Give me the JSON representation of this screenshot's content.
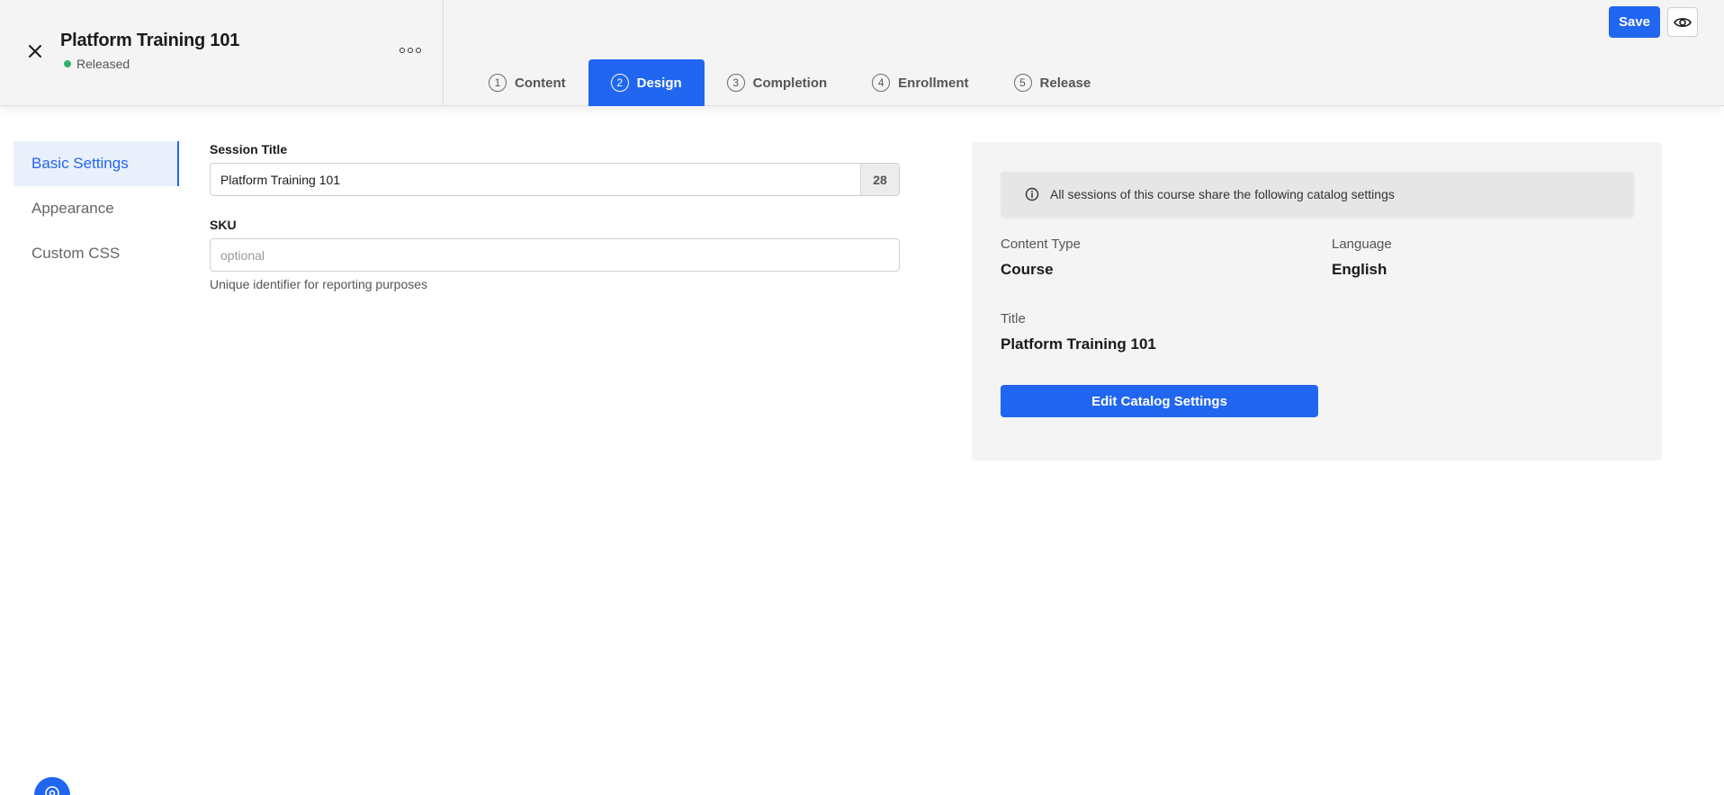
{
  "header": {
    "course_title": "Platform Training 101",
    "status": "Released",
    "status_color": "#2fb36b",
    "save_label": "Save"
  },
  "tabs": [
    {
      "num": "1",
      "label": "Content",
      "active": false
    },
    {
      "num": "2",
      "label": "Design",
      "active": true
    },
    {
      "num": "3",
      "label": "Completion",
      "active": false
    },
    {
      "num": "4",
      "label": "Enrollment",
      "active": false
    },
    {
      "num": "5",
      "label": "Release",
      "active": false
    }
  ],
  "side_nav": {
    "items": [
      {
        "label": "Basic Settings",
        "active": true
      },
      {
        "label": "Appearance",
        "active": false
      },
      {
        "label": "Custom CSS",
        "active": false
      }
    ]
  },
  "form": {
    "session_title_label": "Session Title",
    "session_title_value": "Platform Training 101",
    "session_title_count": "28",
    "sku_label": "SKU",
    "sku_value": "",
    "sku_placeholder": "optional",
    "sku_helper": "Unique identifier for reporting purposes"
  },
  "catalog": {
    "info_text": "All sessions of this course share the following catalog settings",
    "content_type_label": "Content Type",
    "content_type_value": "Course",
    "language_label": "Language",
    "language_value": "English",
    "title_label": "Title",
    "title_value": "Platform Training 101",
    "edit_button_label": "Edit Catalog Settings"
  },
  "icons": {
    "close": "close-icon",
    "more": "more-horizontal-icon",
    "preview": "eye-icon",
    "info": "info-icon",
    "help": "help-icon"
  },
  "colors": {
    "accent": "#2166f0",
    "header_bg": "#f4f4f4",
    "panel_bg": "#f4f4f4"
  }
}
